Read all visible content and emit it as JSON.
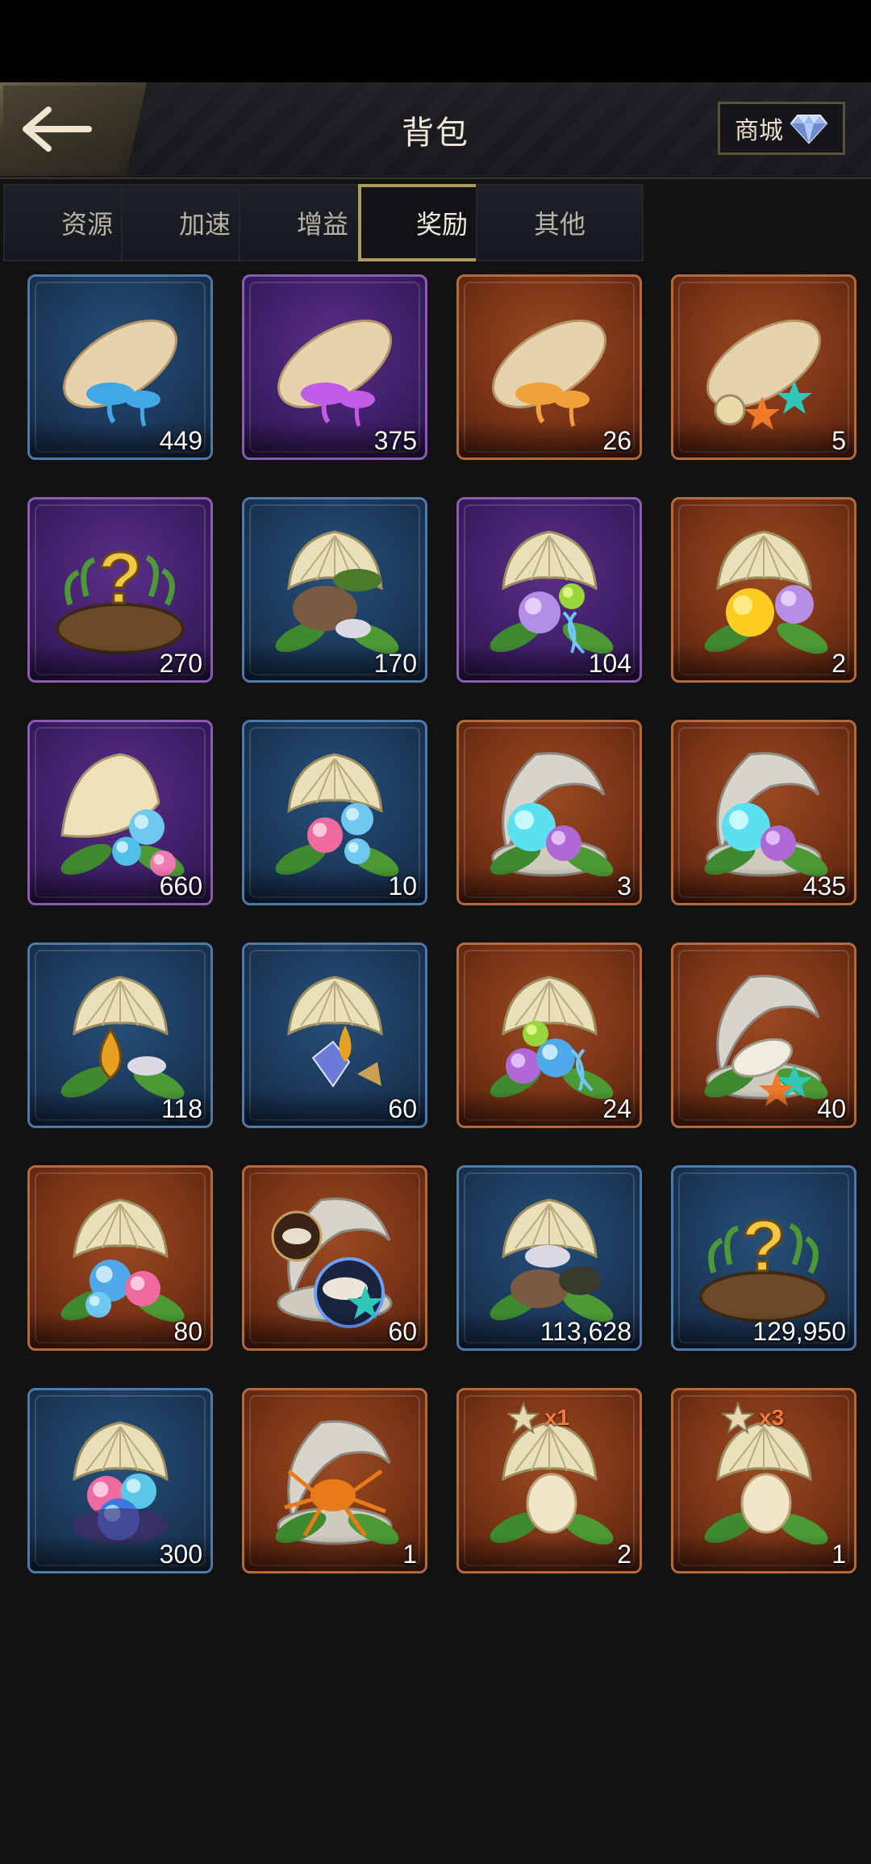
{
  "header": {
    "title": "背包",
    "shop_label": "商城",
    "back_icon": "back-arrow-icon",
    "shop_icon": "diamond-icon"
  },
  "tabs": [
    {
      "label": "资源",
      "active": false
    },
    {
      "label": "加速",
      "active": false
    },
    {
      "label": "增益",
      "active": false
    },
    {
      "label": "奖励",
      "active": true
    },
    {
      "label": "其他",
      "active": false
    }
  ],
  "colors": {
    "rarity_blue": "#4e79a8",
    "rarity_purple": "#8b5cb4",
    "rarity_orange": "#b46a3d",
    "tab_active_border": "#b09a5e"
  },
  "items": [
    {
      "rarity": "blue",
      "art": "cocoon-blue-mushroom-icon",
      "count": "449"
    },
    {
      "rarity": "purple",
      "art": "cocoon-purple-mushroom-icon",
      "count": "375"
    },
    {
      "rarity": "orange",
      "art": "cocoon-orange-mushroom-icon",
      "count": "26"
    },
    {
      "rarity": "orange",
      "art": "cocoon-starfish-shell-icon",
      "count": "5"
    },
    {
      "rarity": "purple",
      "art": "mystery-nest-icon",
      "count": "270"
    },
    {
      "rarity": "blue",
      "art": "shell-stone-isopod-icon",
      "count": "170"
    },
    {
      "rarity": "purple",
      "art": "shell-dna-orbs-icon",
      "count": "104"
    },
    {
      "rarity": "orange",
      "art": "shell-sun-orbs-icon",
      "count": "2"
    },
    {
      "rarity": "purple",
      "art": "scallop-pearls-icon",
      "count": "660"
    },
    {
      "rarity": "blue",
      "art": "shell-pink-pearls-icon",
      "count": "10"
    },
    {
      "rarity": "orange",
      "art": "clam-cyan-purple-pearls-icon",
      "count": "3"
    },
    {
      "rarity": "orange",
      "art": "clam-cyan-purple-pearls-icon",
      "count": "435"
    },
    {
      "rarity": "blue",
      "art": "shell-amber-drop-icon",
      "count": "118"
    },
    {
      "rarity": "blue",
      "art": "shell-gem-amber-icon",
      "count": "60"
    },
    {
      "rarity": "orange",
      "art": "shell-dna-pearls-icon",
      "count": "24"
    },
    {
      "rarity": "orange",
      "art": "clam-cocoon-starfish-icon",
      "count": "40"
    },
    {
      "rarity": "orange",
      "art": "shell-blue-pink-pearls-icon",
      "count": "80"
    },
    {
      "rarity": "orange",
      "art": "clam-cocoon-orbs-icon",
      "count": "60"
    },
    {
      "rarity": "blue",
      "art": "shell-isopod-stones-icon",
      "count": "113,628"
    },
    {
      "rarity": "blue",
      "art": "mystery-nest-icon",
      "count": "129,950"
    },
    {
      "rarity": "blue",
      "art": "shell-pink-blue-pearls-icon",
      "count": "300"
    },
    {
      "rarity": "orange",
      "art": "clam-spider-icon",
      "count": "1"
    },
    {
      "rarity": "orange",
      "art": "shell-egg-icon",
      "count": "2",
      "badge": "x1"
    },
    {
      "rarity": "orange",
      "art": "shell-egg-icon",
      "count": "1",
      "badge": "x3"
    }
  ]
}
